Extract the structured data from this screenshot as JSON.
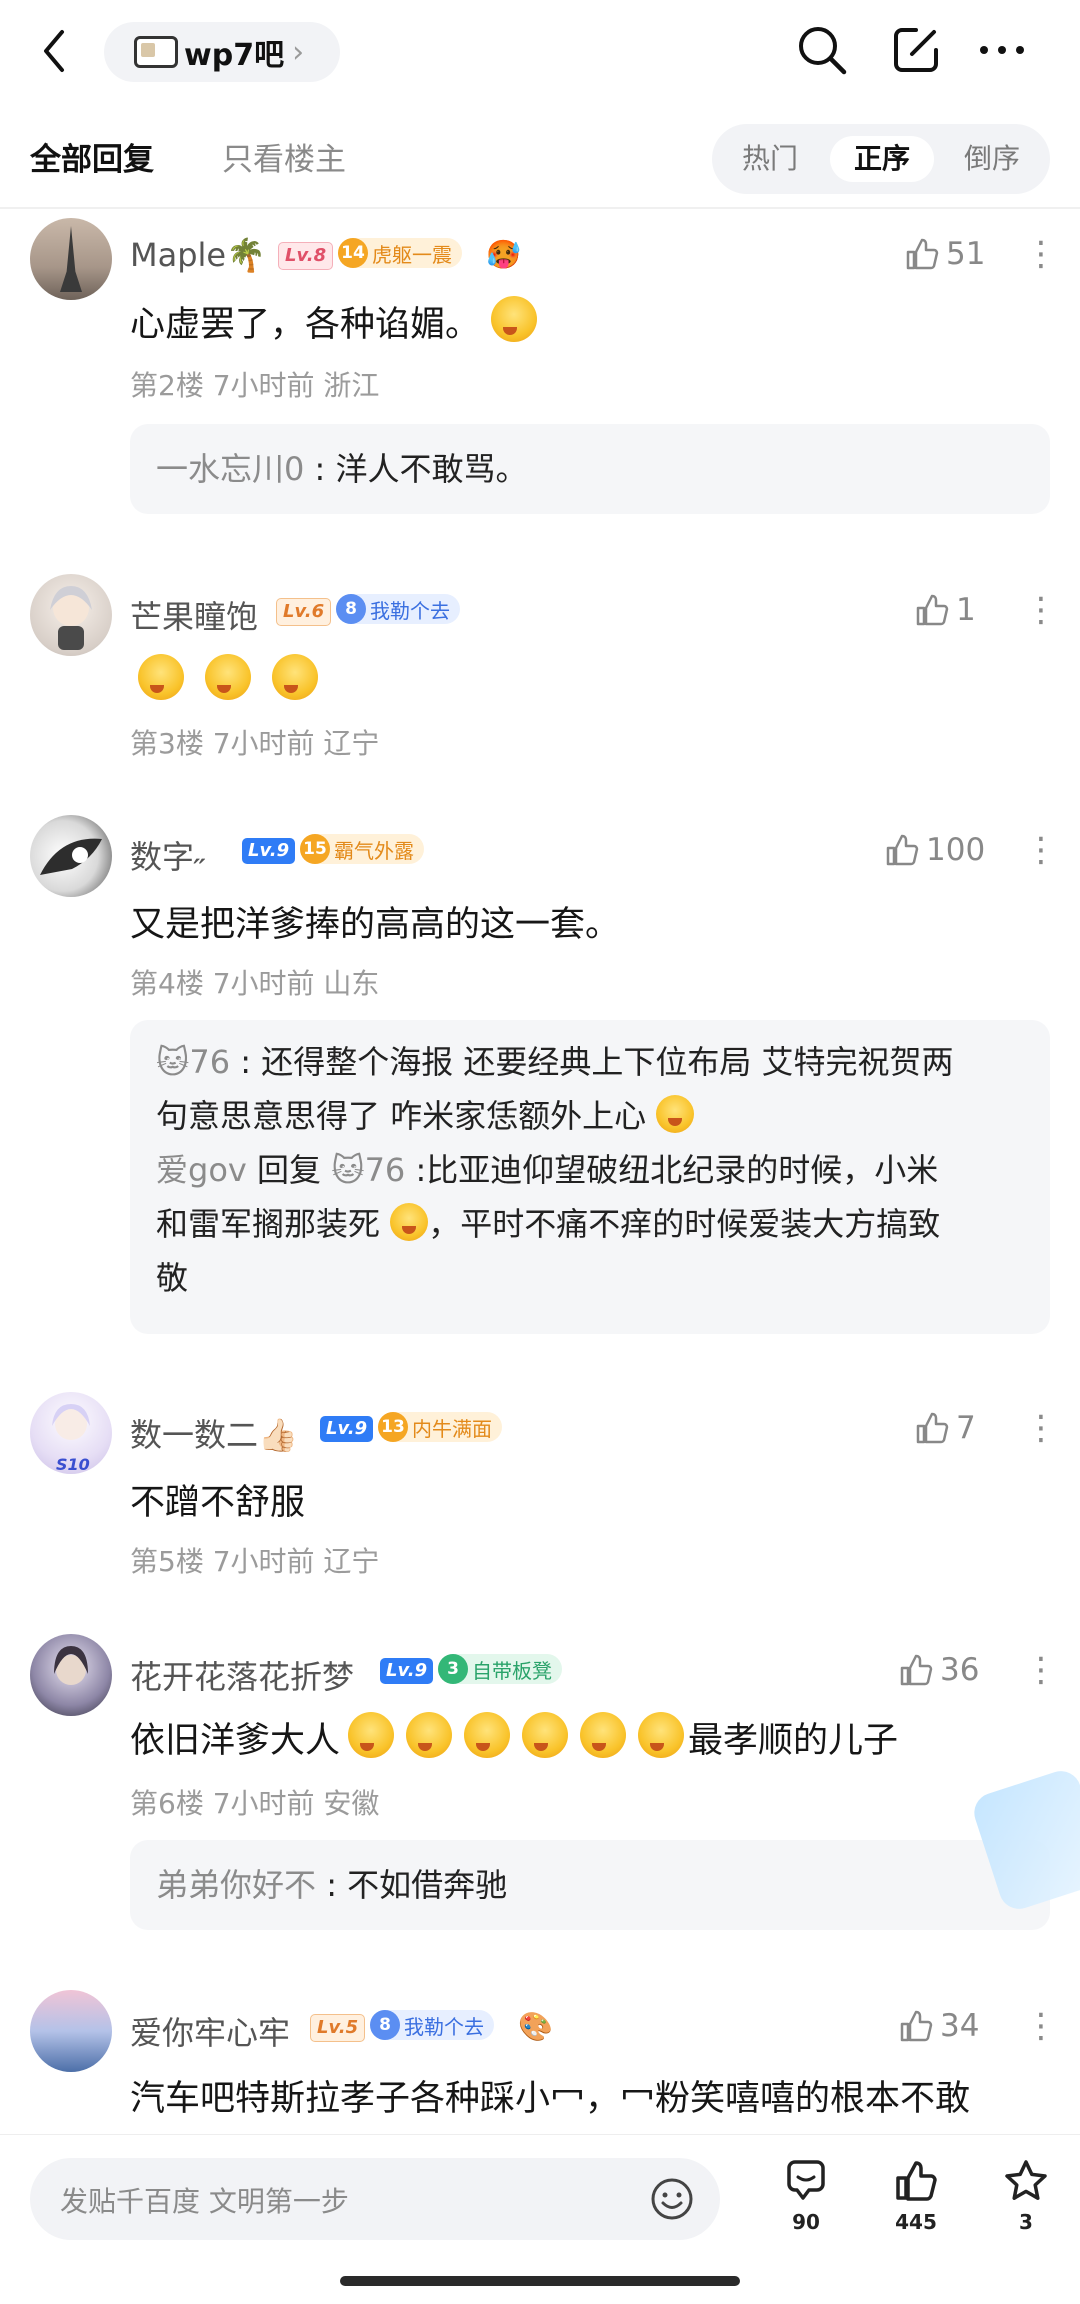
{
  "header": {
    "forum_name": "wp7吧",
    "forum_chevron": "›"
  },
  "filters": {
    "tab_all": "全部回复",
    "tab_op": "只看楼主",
    "sort_hot": "热门",
    "sort_asc": "正序",
    "sort_desc": "倒序",
    "active_sort": "正序"
  },
  "posts": [
    {
      "username": "Maple🌴",
      "level": "Lv.8",
      "badge_num": "14",
      "badge_text": "虎躯一震",
      "content": "心虚罢了，各种谄媚。",
      "meta": "第2楼 7小时前 浙江",
      "likes": "51",
      "reply": {
        "name": "一水忘川0",
        "text": " : 洋人不敢骂。"
      }
    },
    {
      "username": "芒果瞳饱",
      "level": "Lv.6",
      "badge_num": "8",
      "badge_text": "我勒个去",
      "content": "",
      "meta": "第3楼 7小时前 辽宁",
      "likes": "1"
    },
    {
      "username": "数字˶",
      "level": "Lv.9",
      "badge_num": "15",
      "badge_text": "霸气外露",
      "content": "又是把洋爹捧的高高的这一套。",
      "meta": "第4楼 7小时前 山东",
      "likes": "100",
      "replies": [
        {
          "name": "🐱76",
          "line1": " : 还得整个海报 还要经典上下位布局 艾特完祝贺两",
          "line2": "句意思意思得了 咋米家恁额外上心"
        },
        {
          "name": "爱gov",
          "mid": " 回复 ",
          "target": "🐱76",
          "line1": " :比亚迪仰望破纽北纪录的时候，小米",
          "line2a": "和雷军搁那装死",
          "line2b": "，平时不痛不痒的时候爱装大方搞致",
          "line3": "敬"
        }
      ]
    },
    {
      "username": "数一数二👍🏻",
      "level": "Lv.9",
      "badge_num": "13",
      "badge_text": "内牛满面",
      "avatar_tag": "S10",
      "content": "不蹭不舒服",
      "meta": "第5楼 7小时前 辽宁",
      "likes": "7"
    },
    {
      "username": "花开花落花折梦",
      "level": "Lv.9",
      "badge_num": "3",
      "badge_text": "自带板凳",
      "content_a": "依旧洋爹大人",
      "content_b": "最孝顺的儿子",
      "meta": "第6楼 7小时前 安徽",
      "likes": "36",
      "reply": {
        "name": "弟弟你好不",
        "text": " : 不如借奔驰"
      }
    },
    {
      "username": "爱你牢心牢",
      "level": "Lv.5",
      "badge_num": "8",
      "badge_text": "我勒个去",
      "content": "汽车吧特斯拉孝子各种踩小冖，冖粉笑嘻嘻的根本不敢",
      "likes": "34"
    }
  ],
  "bottom": {
    "input_placeholder": "发贴千百度 文明第一步",
    "comments": "90",
    "likes": "445",
    "favorites": "3"
  }
}
